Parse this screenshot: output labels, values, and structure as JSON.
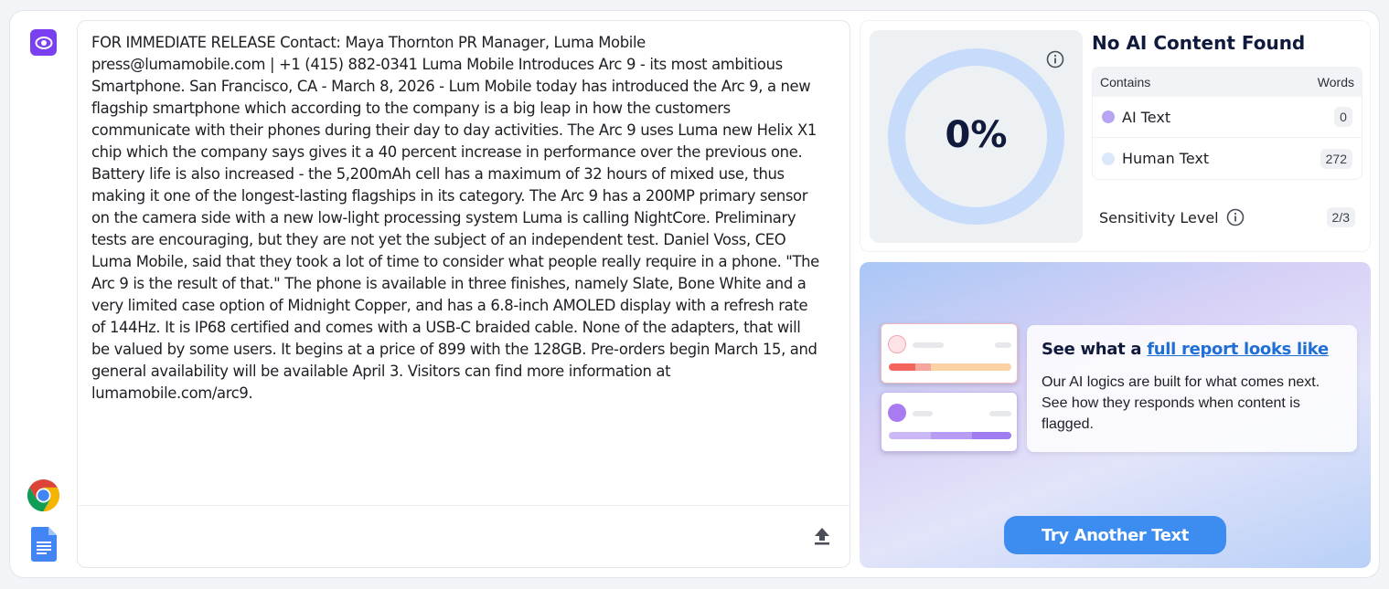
{
  "app": {
    "icons": {
      "logo": "eye-icon",
      "chrome": "chrome-icon",
      "docs": "google-docs-icon",
      "upload": "upload-icon"
    }
  },
  "editor": {
    "text": "FOR IMMEDIATE RELEASE Contact: Maya Thornton PR Manager, Luma Mobile press@lumamobile.com | +1 (415) 882-0341 Luma Mobile Introduces Arc 9 - its most ambitious Smartphone. San Francisco, CA - March 8, 2026 - Lum Mobile today has introduced the Arc 9, a new flagship smartphone which according to the company is a big leap in how the customers communicate with their phones during their day to day activities. The Arc 9 uses Luma new Helix X1 chip which the company says gives it a 40 percent increase in performance over the previous one. Battery life is also increased - the 5,200mAh cell has a maximum of 32 hours of mixed use, thus making it one of the longest-lasting flagships in its category. The Arc 9 has a 200MP primary sensor on the camera side with a new low-light processing system Luma is calling NightCore. Preliminary tests are encouraging, but they are not yet the subject of an independent test. Daniel Voss, CEO Luma Mobile, said that they took a lot of time to consider what people really require in a phone. \"The Arc 9 is the result of that.\" The phone is available in three finishes, namely Slate, Bone White and a very limited case option of Midnight Copper, and has a 6.8-inch AMOLED display with a refresh rate of 144Hz. It is IP68 certified and comes with a USB-C braided cable. None of the adapters, that will be valued by some users. It begins at a price of 899 with the 128GB. Pre-orders begin March 15, and general availability will be available April 3. Visitors can find more information at lumamobile.com/arc9."
  },
  "result": {
    "percent": "0%",
    "percent_value": 0,
    "title": "No AI Content Found",
    "table": {
      "col_contains": "Contains",
      "col_words": "Words",
      "rows": [
        {
          "label": "AI Text",
          "count": "0",
          "color": "#b9a4f2"
        },
        {
          "label": "Human Text",
          "count": "272",
          "color": "#dbe7fb"
        }
      ]
    },
    "sensitivity": {
      "label": "Sensitivity Level",
      "value": "2/3"
    },
    "colors": {
      "gauge_ring": "#c7dbfa",
      "accent": "#7b3ff2"
    }
  },
  "promo": {
    "heading_prefix": "See what a ",
    "heading_link": "full report looks like",
    "description": "Our AI logics are built for what comes next. See how they responds when content is flagged.",
    "button": "Try Another Text"
  }
}
